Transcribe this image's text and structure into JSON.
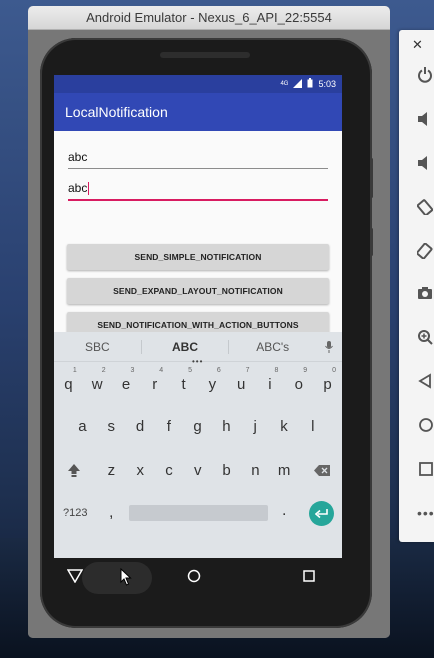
{
  "window": {
    "title": "Android Emulator - Nexus_6_API_22:5554"
  },
  "status_bar": {
    "network": "4G",
    "time": "5:03"
  },
  "app": {
    "title": "LocalNotification"
  },
  "fields": [
    {
      "value": "abc"
    },
    {
      "value": "abc"
    }
  ],
  "buttons": {
    "simple": "SEND_SIMPLE_NOTIFICATION",
    "expand": "SEND_EXPAND_LAYOUT_NOTIFICATION",
    "action": "SEND_NOTIFICATION_WITH_ACTION_BUTTONS"
  },
  "keyboard": {
    "suggestions": [
      "SBC",
      "ABC",
      "ABC's"
    ],
    "row1": [
      {
        "k": "q",
        "n": "1"
      },
      {
        "k": "w",
        "n": "2"
      },
      {
        "k": "e",
        "n": "3"
      },
      {
        "k": "r",
        "n": "4"
      },
      {
        "k": "t",
        "n": "5"
      },
      {
        "k": "y",
        "n": "6"
      },
      {
        "k": "u",
        "n": "7"
      },
      {
        "k": "i",
        "n": "8"
      },
      {
        "k": "o",
        "n": "9"
      },
      {
        "k": "p",
        "n": "0"
      }
    ],
    "row2": [
      "a",
      "s",
      "d",
      "f",
      "g",
      "h",
      "j",
      "k",
      "l"
    ],
    "row3": [
      "z",
      "x",
      "c",
      "v",
      "b",
      "n",
      "m"
    ],
    "symbols": "?123",
    "comma": ",",
    "period": "."
  },
  "colors": {
    "primary": "#3148b5",
    "primary_dark": "#2a3f9e",
    "accent": "#d81b60",
    "enter_key": "#26a69a"
  }
}
